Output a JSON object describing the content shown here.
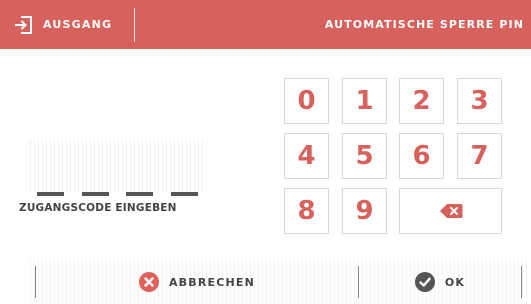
{
  "header": {
    "exit_label": "AUSGANG",
    "title": "AUTOMATISCHE SPERRE PIN",
    "exit_icon": "exit-icon",
    "background_color": "#d6615d"
  },
  "code_entry": {
    "label": "ZUGANGSCODE EINGEBEN",
    "digits_entered": 0,
    "max_digits": 4
  },
  "keypad": {
    "keys": [
      "0",
      "1",
      "2",
      "3",
      "4",
      "5",
      "6",
      "7",
      "8",
      "9"
    ],
    "backspace_icon": "backspace-icon",
    "accent_color": "#d6615d"
  },
  "footer": {
    "cancel_label": "ABBRECHEN",
    "cancel_icon": "cancel-icon",
    "cancel_color": "#e0605c",
    "ok_label": "OK",
    "ok_icon": "check-icon",
    "ok_color": "#555555"
  }
}
